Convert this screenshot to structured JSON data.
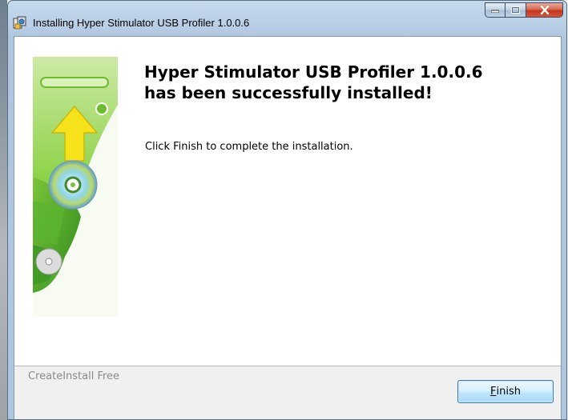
{
  "window": {
    "title": "Installing Hyper Stimulator USB Profiler 1.0.0.6"
  },
  "content": {
    "heading": "Hyper Stimulator USB Profiler 1.0.0.6\nhas been successfully installed!",
    "message": "Click Finish to complete the installation."
  },
  "footer": {
    "brand": "CreateInstall Free",
    "finish_mnemonic": "F",
    "finish_rest": "inish"
  },
  "icons": {
    "banner": "installer-banner-icon",
    "app": "installer-app-icon",
    "minimize": "minimize-icon",
    "maximize": "maximize-icon",
    "close": "close-icon"
  },
  "colors": {
    "accent_green": "#6cbc2c",
    "arrow_yellow": "#f6e21a",
    "button_border": "#3d7bad"
  }
}
